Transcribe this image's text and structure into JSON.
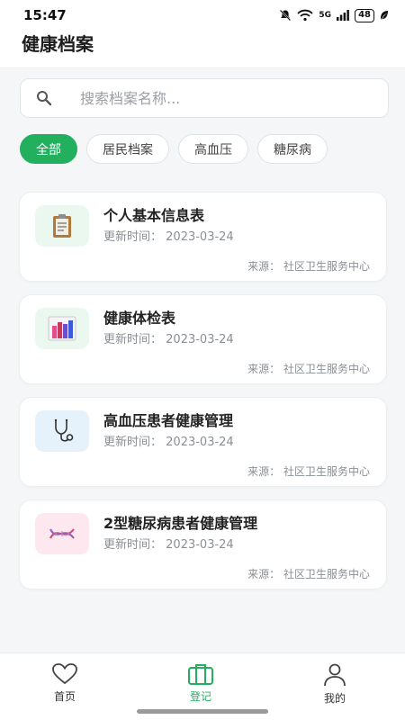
{
  "status_bar": {
    "time": "15:47",
    "network": "5G",
    "battery": "48"
  },
  "header": {
    "title": "健康档案"
  },
  "search": {
    "placeholder": "搜索档案名称..."
  },
  "filters": [
    {
      "label": "全部",
      "active": true
    },
    {
      "label": "居民档案",
      "active": false
    },
    {
      "label": "高血压",
      "active": false
    },
    {
      "label": "糖尿病",
      "active": false
    }
  ],
  "records": [
    {
      "title": "个人基本信息表",
      "date_label": "更新时间：",
      "date": "2023-03-24",
      "source_label": "来源：",
      "source": "社区卫生服务中心",
      "icon": "clipboard-icon"
    },
    {
      "title": "健康体检表",
      "date_label": "更新时间：",
      "date": "2023-03-24",
      "source_label": "来源：",
      "source": "社区卫生服务中心",
      "icon": "bar-chart-icon"
    },
    {
      "title": "高血压患者健康管理",
      "date_label": "更新时间：",
      "date": "2023-03-24",
      "source_label": "来源：",
      "source": "社区卫生服务中心",
      "icon": "stethoscope-icon"
    },
    {
      "title": "2型糖尿病患者健康管理",
      "date_label": "更新时间：",
      "date": "2023-03-24",
      "source_label": "来源：",
      "source": "社区卫生服务中心",
      "icon": "dna-icon"
    }
  ],
  "bottom_nav": [
    {
      "label": "首页",
      "icon": "heart-icon",
      "active": false
    },
    {
      "label": "登记",
      "icon": "briefcase-icon",
      "active": true
    },
    {
      "label": "我的",
      "icon": "user-icon",
      "active": false
    }
  ],
  "colors": {
    "accent": "#22b05f",
    "icon_bg_green": "#eaf8f0",
    "icon_bg_blue": "#e6f2fb",
    "icon_bg_pink": "#fde8f0"
  }
}
